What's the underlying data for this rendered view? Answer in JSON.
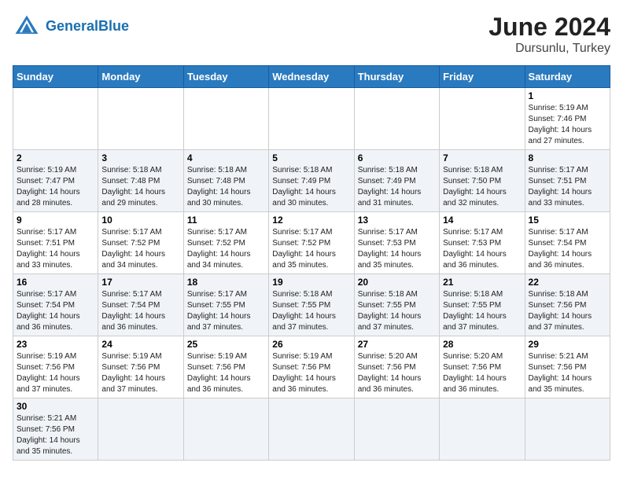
{
  "header": {
    "logo_general": "General",
    "logo_blue": "Blue",
    "month": "June 2024",
    "location": "Dursunlu, Turkey"
  },
  "days_of_week": [
    "Sunday",
    "Monday",
    "Tuesday",
    "Wednesday",
    "Thursday",
    "Friday",
    "Saturday"
  ],
  "weeks": [
    [
      {
        "day": "",
        "info": ""
      },
      {
        "day": "",
        "info": ""
      },
      {
        "day": "",
        "info": ""
      },
      {
        "day": "",
        "info": ""
      },
      {
        "day": "",
        "info": ""
      },
      {
        "day": "",
        "info": ""
      },
      {
        "day": "1",
        "info": "Sunrise: 5:19 AM\nSunset: 7:46 PM\nDaylight: 14 hours and 27 minutes."
      }
    ],
    [
      {
        "day": "2",
        "info": "Sunrise: 5:19 AM\nSunset: 7:47 PM\nDaylight: 14 hours and 28 minutes."
      },
      {
        "day": "3",
        "info": "Sunrise: 5:18 AM\nSunset: 7:48 PM\nDaylight: 14 hours and 29 minutes."
      },
      {
        "day": "4",
        "info": "Sunrise: 5:18 AM\nSunset: 7:48 PM\nDaylight: 14 hours and 30 minutes."
      },
      {
        "day": "5",
        "info": "Sunrise: 5:18 AM\nSunset: 7:49 PM\nDaylight: 14 hours and 30 minutes."
      },
      {
        "day": "6",
        "info": "Sunrise: 5:18 AM\nSunset: 7:49 PM\nDaylight: 14 hours and 31 minutes."
      },
      {
        "day": "7",
        "info": "Sunrise: 5:18 AM\nSunset: 7:50 PM\nDaylight: 14 hours and 32 minutes."
      },
      {
        "day": "8",
        "info": "Sunrise: 5:17 AM\nSunset: 7:51 PM\nDaylight: 14 hours and 33 minutes."
      }
    ],
    [
      {
        "day": "9",
        "info": "Sunrise: 5:17 AM\nSunset: 7:51 PM\nDaylight: 14 hours and 33 minutes."
      },
      {
        "day": "10",
        "info": "Sunrise: 5:17 AM\nSunset: 7:52 PM\nDaylight: 14 hours and 34 minutes."
      },
      {
        "day": "11",
        "info": "Sunrise: 5:17 AM\nSunset: 7:52 PM\nDaylight: 14 hours and 34 minutes."
      },
      {
        "day": "12",
        "info": "Sunrise: 5:17 AM\nSunset: 7:52 PM\nDaylight: 14 hours and 35 minutes."
      },
      {
        "day": "13",
        "info": "Sunrise: 5:17 AM\nSunset: 7:53 PM\nDaylight: 14 hours and 35 minutes."
      },
      {
        "day": "14",
        "info": "Sunrise: 5:17 AM\nSunset: 7:53 PM\nDaylight: 14 hours and 36 minutes."
      },
      {
        "day": "15",
        "info": "Sunrise: 5:17 AM\nSunset: 7:54 PM\nDaylight: 14 hours and 36 minutes."
      }
    ],
    [
      {
        "day": "16",
        "info": "Sunrise: 5:17 AM\nSunset: 7:54 PM\nDaylight: 14 hours and 36 minutes."
      },
      {
        "day": "17",
        "info": "Sunrise: 5:17 AM\nSunset: 7:54 PM\nDaylight: 14 hours and 36 minutes."
      },
      {
        "day": "18",
        "info": "Sunrise: 5:17 AM\nSunset: 7:55 PM\nDaylight: 14 hours and 37 minutes."
      },
      {
        "day": "19",
        "info": "Sunrise: 5:18 AM\nSunset: 7:55 PM\nDaylight: 14 hours and 37 minutes."
      },
      {
        "day": "20",
        "info": "Sunrise: 5:18 AM\nSunset: 7:55 PM\nDaylight: 14 hours and 37 minutes."
      },
      {
        "day": "21",
        "info": "Sunrise: 5:18 AM\nSunset: 7:55 PM\nDaylight: 14 hours and 37 minutes."
      },
      {
        "day": "22",
        "info": "Sunrise: 5:18 AM\nSunset: 7:56 PM\nDaylight: 14 hours and 37 minutes."
      }
    ],
    [
      {
        "day": "23",
        "info": "Sunrise: 5:19 AM\nSunset: 7:56 PM\nDaylight: 14 hours and 37 minutes."
      },
      {
        "day": "24",
        "info": "Sunrise: 5:19 AM\nSunset: 7:56 PM\nDaylight: 14 hours and 37 minutes."
      },
      {
        "day": "25",
        "info": "Sunrise: 5:19 AM\nSunset: 7:56 PM\nDaylight: 14 hours and 36 minutes."
      },
      {
        "day": "26",
        "info": "Sunrise: 5:19 AM\nSunset: 7:56 PM\nDaylight: 14 hours and 36 minutes."
      },
      {
        "day": "27",
        "info": "Sunrise: 5:20 AM\nSunset: 7:56 PM\nDaylight: 14 hours and 36 minutes."
      },
      {
        "day": "28",
        "info": "Sunrise: 5:20 AM\nSunset: 7:56 PM\nDaylight: 14 hours and 36 minutes."
      },
      {
        "day": "29",
        "info": "Sunrise: 5:21 AM\nSunset: 7:56 PM\nDaylight: 14 hours and 35 minutes."
      }
    ],
    [
      {
        "day": "30",
        "info": "Sunrise: 5:21 AM\nSunset: 7:56 PM\nDaylight: 14 hours and 35 minutes."
      },
      {
        "day": "",
        "info": ""
      },
      {
        "day": "",
        "info": ""
      },
      {
        "day": "",
        "info": ""
      },
      {
        "day": "",
        "info": ""
      },
      {
        "day": "",
        "info": ""
      },
      {
        "day": "",
        "info": ""
      }
    ]
  ]
}
